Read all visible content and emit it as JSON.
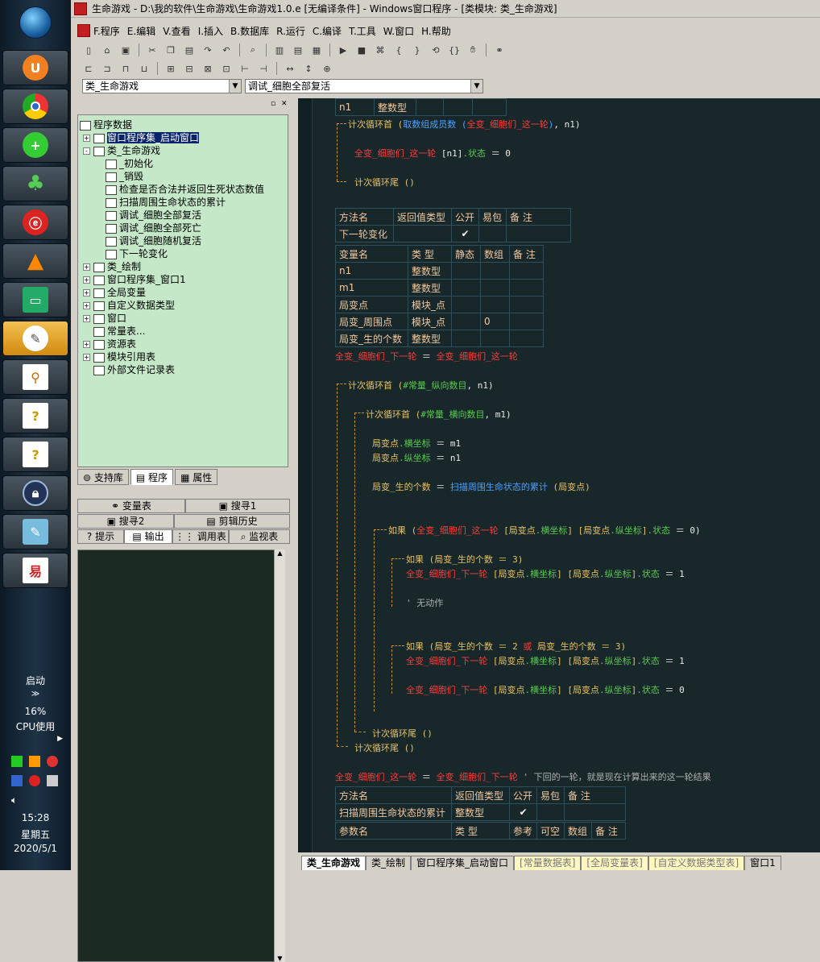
{
  "taskbar": {
    "apps": [
      "start-orb",
      "uc-browser",
      "chrome",
      "360-safe",
      "clover",
      "netease-music",
      "vlc",
      "monitor",
      "active-app",
      "search-doc",
      "help-1",
      "help-2",
      "lock",
      "notepad",
      "e-language"
    ],
    "startup_label": "启动",
    "cpu_percent": "16%",
    "cpu_label": "CPU使用",
    "time": "15:28",
    "weekday": "星期五",
    "date": "2020/5/1"
  },
  "window": {
    "title": "生命游戏 - D:\\我的软件\\生命游戏\\生命游戏1.0.e [无编译条件] - Windows窗口程序 - [类模块: 类_生命游戏]"
  },
  "menu": [
    "F.程序",
    "E.编辑",
    "V.查看",
    "I.插入",
    "B.数据库",
    "R.运行",
    "C.编译",
    "T.工具",
    "W.窗口",
    "H.帮助"
  ],
  "combos": {
    "left": "类_生命游戏",
    "right": "调试_细胞全部复活"
  },
  "tree": [
    {
      "label": "程序数据",
      "level": 0,
      "exp": ""
    },
    {
      "label": "窗口程序集_启动窗口",
      "level": 1,
      "exp": "+",
      "selected": true
    },
    {
      "label": "类_生命游戏",
      "level": 1,
      "exp": "-"
    },
    {
      "label": "_初始化",
      "level": 2,
      "exp": ""
    },
    {
      "label": "_销毁",
      "level": 2,
      "exp": ""
    },
    {
      "label": "检查是否合法并返回生死状态数值",
      "level": 2,
      "exp": ""
    },
    {
      "label": "扫描周围生命状态的累计",
      "level": 2,
      "exp": ""
    },
    {
      "label": "调试_细胞全部复活",
      "level": 2,
      "exp": ""
    },
    {
      "label": "调试_细胞全部死亡",
      "level": 2,
      "exp": ""
    },
    {
      "label": "调试_细胞随机复活",
      "level": 2,
      "exp": ""
    },
    {
      "label": "下一轮变化",
      "level": 2,
      "exp": ""
    },
    {
      "label": "类_绘制",
      "level": 1,
      "exp": "+"
    },
    {
      "label": "窗口程序集_窗口1",
      "level": 1,
      "exp": "+"
    },
    {
      "label": "全局变量",
      "level": 1,
      "exp": "+"
    },
    {
      "label": "自定义数据类型",
      "level": 1,
      "exp": "+"
    },
    {
      "label": "窗口",
      "level": 1,
      "exp": "+"
    },
    {
      "label": "常量表...",
      "level": 1,
      "exp": ""
    },
    {
      "label": "资源表",
      "level": 1,
      "exp": "+"
    },
    {
      "label": "模块引用表",
      "level": 1,
      "exp": "+"
    },
    {
      "label": "外部文件记录表",
      "level": 1,
      "exp": ""
    }
  ],
  "panel_tabs": [
    "支持库",
    "程序",
    "属性"
  ],
  "output_tabs_row1": [
    "变量表",
    "搜寻1"
  ],
  "output_tabs_row2": [
    "搜寻2",
    "剪辑历史"
  ],
  "output_tabs_row3": [
    "提示",
    "输出",
    "调用表",
    "监视表"
  ],
  "code": {
    "top_row": [
      "n1",
      "整数型"
    ],
    "loop1": [
      "计次循环首 (",
      "取数组成员数 (",
      "全变_细胞们_这一轮",
      ")",
      ", n1)"
    ],
    "assign1": [
      "全变_细胞们_这一轮",
      " [n1]",
      ".状态",
      " ＝ 0"
    ],
    "loop1_end": "计次循环尾 ()",
    "method_header": [
      "方法名",
      "返回值类型",
      "公开",
      "易包",
      "备 注"
    ],
    "method_row": {
      "name": "下一轮变化",
      "public": "✔"
    },
    "var_header": [
      "变量名",
      "类 型",
      "静态",
      "数组",
      "备 注"
    ],
    "vars": [
      {
        "name": "n1",
        "type": "整数型",
        "arr": ""
      },
      {
        "name": "m1",
        "type": "整数型",
        "arr": ""
      },
      {
        "name": "局变点",
        "type": "模块_点",
        "arr": ""
      },
      {
        "name": "局变_周围点",
        "type": "模块_点",
        "arr": "0"
      },
      {
        "name": "局变_生的个数",
        "type": "整数型",
        "arr": ""
      }
    ],
    "assign2": [
      "全变_细胞们_下一轮",
      " ＝ ",
      "全变_细胞们_这一轮"
    ],
    "loop2": [
      "计次循环首 (",
      "#常量_纵向数目",
      ", n1)"
    ],
    "loop3": [
      "计次循环首 (",
      "#常量_横向数目",
      ", m1)"
    ],
    "a_x": [
      "局变点",
      ".横坐标",
      " ＝ m1"
    ],
    "a_y": [
      "局变点",
      ".纵坐标",
      " ＝ n1"
    ],
    "a_count": [
      "局变_生的个数",
      " ＝ ",
      "扫描周围生命状态的累计",
      " (局变点)"
    ],
    "if1": [
      "如果 (",
      "全变_细胞们_这一轮",
      " [局变点",
      ".横坐标",
      "] [局变点",
      ".纵坐标",
      "]",
      ".状态",
      " ＝ 0)"
    ],
    "if2": [
      "如果 (局变_生的个数 ＝ 3)"
    ],
    "set1": [
      "全变_细胞们_下一轮",
      " [局变点",
      ".横坐标",
      "] [局变点",
      ".纵坐标",
      "]",
      ".状态",
      " ＝ 1"
    ],
    "comment1": "' 无动作",
    "if3": [
      "如果 (局变_生的个数 ＝ 2 ",
      "或",
      " 局变_生的个数 ＝ 3)"
    ],
    "set2": [
      "全变_细胞们_下一轮",
      " [局变点",
      ".横坐标",
      "] [局变点",
      ".纵坐标",
      "]",
      ".状态",
      " ＝ 1"
    ],
    "set3": [
      "全变_细胞们_下一轮",
      " [局变点",
      ".横坐标",
      "] [局变点",
      ".纵坐标",
      "]",
      ".状态",
      " ＝ 0"
    ],
    "loop3_end": "计次循环尾 ()",
    "loop2_end": "计次循环尾 ()",
    "assign3": [
      "全变_细胞们_这一轮",
      " ＝ ",
      "全变_细胞们_下一轮",
      "  ' 下回的一轮，就是现在计算出来的这一轮结果"
    ],
    "method2_header": [
      "方法名",
      "返回值类型",
      "公开",
      "易包",
      "备 注"
    ],
    "method2_row": {
      "name": "扫描周围生命状态的累计",
      "ret": "整数型",
      "public": "✔"
    },
    "param_header": [
      "参数名",
      "类 型",
      "参考",
      "可空",
      "数组",
      "备 注"
    ]
  },
  "bottom_tabs": [
    "类_生命游戏",
    "类_绘制",
    "窗口程序集_启动窗口",
    "[常量数据表]",
    "[全局变量表]",
    "[自定义数据类型表]",
    "窗口1"
  ],
  "colors": {
    "editor_bg": "#18282a",
    "tree_bg": "#c4e8c8",
    "keyword": "#e8c060",
    "variable": "#ff3a3a",
    "function": "#4aa0ff",
    "constant": "#5ac850"
  }
}
